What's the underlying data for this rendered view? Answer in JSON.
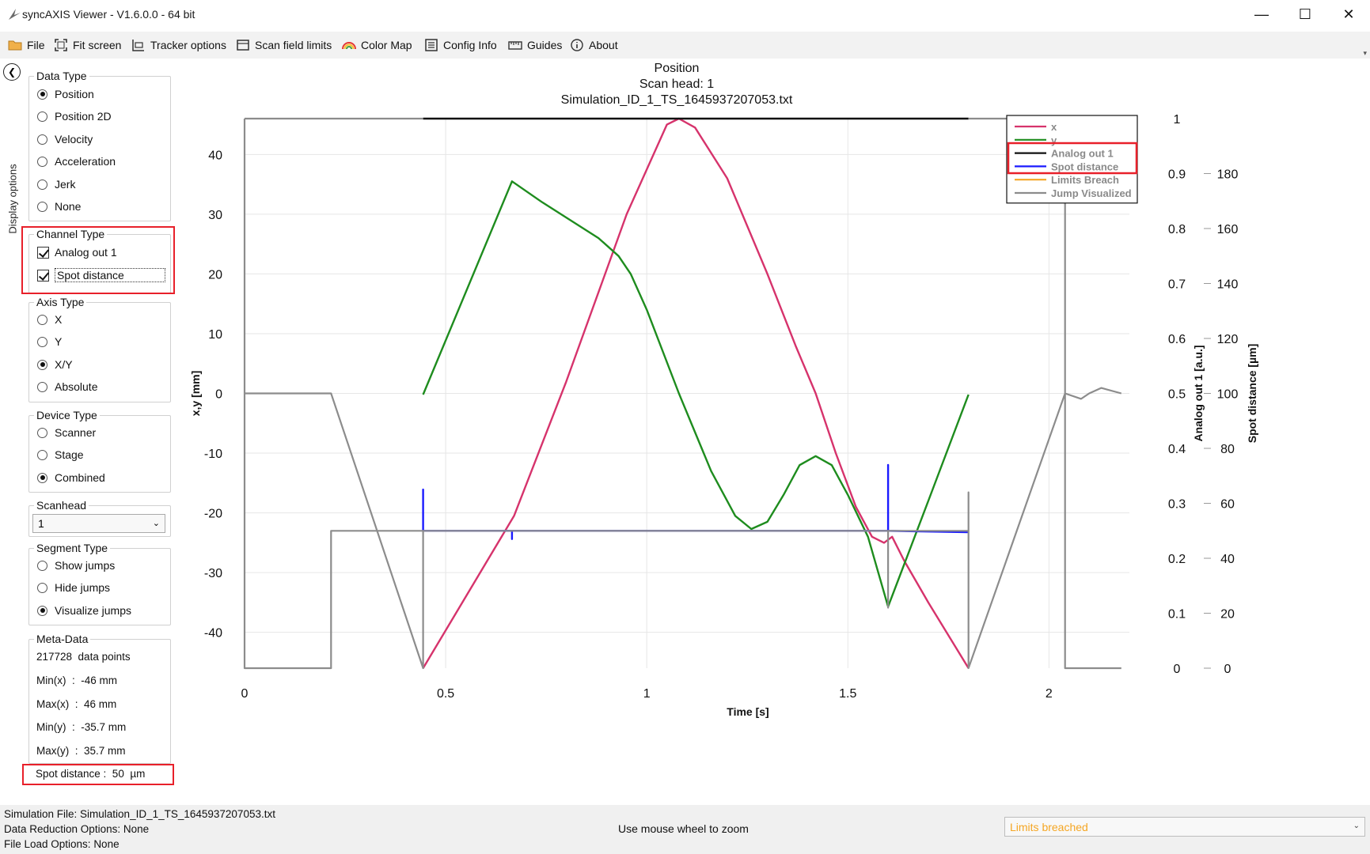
{
  "window": {
    "title": "syncAXIS Viewer - V1.6.0.0 - 64 bit",
    "minimize_glyph": "—",
    "maximize_glyph": "☐",
    "close_glyph": "✕"
  },
  "toolbar": {
    "items": [
      {
        "label": "File",
        "icon": "folder-icon"
      },
      {
        "label": "Fit screen",
        "icon": "fit-screen-icon"
      },
      {
        "label": "Tracker options",
        "icon": "tracker-icon"
      },
      {
        "label": "Scan field limits",
        "icon": "scan-field-icon"
      },
      {
        "label": "Color Map",
        "icon": "rainbow-icon"
      },
      {
        "label": "Config Info",
        "icon": "config-icon"
      },
      {
        "label": "Guides",
        "icon": "guides-icon"
      },
      {
        "label": "About",
        "icon": "info-icon"
      }
    ]
  },
  "side_panel": {
    "tab_label": "Display options",
    "data_type": {
      "title": "Data Type",
      "options": [
        "Position",
        "Position 2D",
        "Velocity",
        "Acceleration",
        "Jerk",
        "None"
      ],
      "selected": "Position"
    },
    "channel_type": {
      "title": "Channel Type",
      "options": [
        {
          "label": "Analog out 1",
          "checked": true
        },
        {
          "label": "Spot distance",
          "checked": true
        }
      ]
    },
    "axis_type": {
      "title": "Axis Type",
      "options": [
        "X",
        "Y",
        "X/Y",
        "Absolute"
      ],
      "selected": "X/Y"
    },
    "device_type": {
      "title": "Device Type",
      "options": [
        "Scanner",
        "Stage",
        "Combined"
      ],
      "selected": "Combined"
    },
    "scanhead": {
      "title": "Scanhead",
      "value": "1"
    },
    "segment_type": {
      "title": "Segment Type",
      "options": [
        "Show jumps",
        "Hide jumps",
        "Visualize jumps"
      ],
      "selected": "Visualize jumps"
    },
    "meta_data": {
      "title": "Meta-Data",
      "lines": [
        "217728  data points",
        "Min(x)  :  -46 mm",
        "Max(x)  :  46 mm",
        "Min(y)  :  -35.7 mm",
        "Max(y)  :  35.7 mm"
      ],
      "spot_distance": "Spot distance :  50  µm"
    }
  },
  "chart_data": {
    "type": "line",
    "title": "Position",
    "subtitle": "Scan head: 1",
    "file_title": "Simulation_ID_1_TS_1645937207053.txt",
    "xlabel": "Time [s]",
    "ylabel_left": "x,y [mm]",
    "ylabel_right1": "Analog out 1 [a.u.]",
    "ylabel_right2": "Spot distance [µm]",
    "xlim": [
      0,
      2.2
    ],
    "ylim_left": [
      -46,
      46
    ],
    "ylim_right1": [
      0,
      1
    ],
    "ylim_right2": [
      0,
      200
    ],
    "x_ticks": [
      {
        "value": 0,
        "label": "0"
      },
      {
        "value": 0.5,
        "label": "0.5"
      },
      {
        "value": 1,
        "label": "1"
      },
      {
        "value": 1.5,
        "label": "1.5"
      },
      {
        "value": 2,
        "label": "2"
      }
    ],
    "y_left_ticks": [
      40,
      30,
      20,
      10,
      0,
      -10,
      -20,
      -30,
      -40
    ],
    "y_left_tick_labels": [
      "40",
      "30",
      "20",
      "10",
      "0",
      "-10",
      "-20",
      "-30",
      "-40"
    ],
    "y_right1_ticks": [
      1,
      0.9,
      0.8,
      0.7,
      0.6,
      0.5,
      0.4,
      0.3,
      0.2,
      0.1,
      0
    ],
    "y_right1_tick_labels": [
      "1",
      "0.9",
      "0.8",
      "0.7",
      "0.6",
      "0.5",
      "0.4",
      "0.3",
      "0.2",
      "0.1",
      "0"
    ],
    "y_right2_ticks": [
      180,
      160,
      140,
      120,
      100,
      80,
      60,
      40,
      20,
      0
    ],
    "y_right2_tick_labels": [
      "180",
      "160",
      "140",
      "120",
      "100",
      "80",
      "60",
      "40",
      "20",
      "0"
    ],
    "grid": true,
    "legend_position": "top-right",
    "series": [
      {
        "name": "x",
        "axis": "left",
        "color": "#d6336c",
        "points": [
          [
            0.444,
            -46
          ],
          [
            0.67,
            -20.5
          ],
          [
            0.8,
            2
          ],
          [
            0.95,
            30
          ],
          [
            1.05,
            45
          ],
          [
            1.08,
            46
          ],
          [
            1.12,
            44.5
          ],
          [
            1.2,
            36
          ],
          [
            1.3,
            20
          ],
          [
            1.37,
            8
          ],
          [
            1.42,
            0
          ],
          [
            1.47,
            -10
          ],
          [
            1.52,
            -19
          ],
          [
            1.56,
            -24
          ],
          [
            1.59,
            -25
          ],
          [
            1.61,
            -24
          ],
          [
            1.64,
            -28
          ],
          [
            1.7,
            -35
          ],
          [
            1.8,
            -46
          ]
        ]
      },
      {
        "name": "y",
        "axis": "left",
        "color": "#1e8c1e",
        "points": [
          [
            0.444,
            -0.2
          ],
          [
            0.665,
            35.5
          ],
          [
            0.74,
            32
          ],
          [
            0.88,
            26
          ],
          [
            0.93,
            23
          ],
          [
            0.96,
            20
          ],
          [
            1.0,
            14
          ],
          [
            1.08,
            0
          ],
          [
            1.16,
            -13
          ],
          [
            1.22,
            -20.5
          ],
          [
            1.26,
            -22.7
          ],
          [
            1.3,
            -21.5
          ],
          [
            1.34,
            -17
          ],
          [
            1.38,
            -12
          ],
          [
            1.42,
            -10.5
          ],
          [
            1.46,
            -12
          ],
          [
            1.5,
            -17
          ],
          [
            1.55,
            -24
          ],
          [
            1.6,
            -35.7
          ],
          [
            1.7,
            -18
          ],
          [
            1.8,
            -0.2
          ]
        ]
      },
      {
        "name": "Analog out 1",
        "axis": "right1",
        "color": "#111111",
        "points": [
          [
            0.444,
            1
          ],
          [
            1.8,
            1
          ]
        ]
      },
      {
        "name": "Spot distance",
        "axis": "right2",
        "color": "#1a1aff",
        "points": [
          [
            0.444,
            50
          ],
          [
            0.444,
            65
          ],
          [
            0.444,
            50
          ],
          [
            0.665,
            50
          ],
          [
            0.665,
            47
          ],
          [
            0.665,
            50
          ],
          [
            1.6,
            50
          ],
          [
            1.6,
            74
          ],
          [
            1.6,
            50
          ],
          [
            1.8,
            49.5
          ]
        ]
      },
      {
        "name": "Limits Breach",
        "axis": "right1",
        "color": "#f5a623",
        "points": []
      },
      {
        "name": "Jump Visualized",
        "axis": "right1",
        "color": "#8c8c8c",
        "points": [
          [
            0,
            0.5
          ],
          [
            0.215,
            0.5
          ],
          [
            0.444,
            0
          ],
          [
            0.444,
            0.155
          ],
          [
            0.444,
            0
          ],
          [
            0.444,
            0.25
          ],
          [
            1.6,
            0.25
          ],
          [
            1.6,
            0.24
          ],
          [
            1.6,
            0.11
          ],
          [
            1.6,
            0.25
          ],
          [
            1.8,
            0.25
          ],
          [
            1.8,
            0.175
          ],
          [
            1.8,
            0.32
          ],
          [
            1.8,
            0
          ],
          [
            2.04,
            0.5
          ],
          [
            2.04,
            1.0
          ],
          [
            2.04,
            0
          ],
          [
            2.04,
            0.25
          ],
          [
            2.04,
            0.5
          ],
          [
            2.08,
            0.49
          ],
          [
            2.1,
            0.5
          ],
          [
            2.13,
            0.51
          ],
          [
            2.18,
            0.5
          ]
        ]
      },
      {
        "name": "Jump Visualized",
        "axis": "right1",
        "color": "#8c8c8c",
        "show_in_legend": false,
        "points": [
          [
            0,
            1
          ],
          [
            0.444,
            1
          ]
        ]
      },
      {
        "name": "Jump Visualized",
        "axis": "right1",
        "color": "#8c8c8c",
        "show_in_legend": false,
        "points": [
          [
            1.8,
            1
          ],
          [
            2.04,
            1
          ]
        ]
      },
      {
        "name": "Jump Visualized",
        "axis": "right1",
        "color": "#8c8c8c",
        "show_in_legend": false,
        "points": [
          [
            0,
            1
          ],
          [
            0,
            0
          ],
          [
            0.215,
            0
          ],
          [
            0.215,
            0.25
          ],
          [
            0.444,
            0.25
          ]
        ]
      },
      {
        "name": "Jump Visualized",
        "axis": "right1",
        "color": "#8c8c8c",
        "show_in_legend": false,
        "points": [
          [
            2.04,
            0
          ],
          [
            2.18,
            0
          ]
        ]
      }
    ]
  },
  "status_bar": {
    "simulation_file": "Simulation File: Simulation_ID_1_TS_1645937207053.txt",
    "data_reduction": "Data Reduction Options: None",
    "file_load": "File Load Options:  None",
    "zoom_hint": "Use mouse wheel to zoom",
    "limits_status": "Limits breached"
  },
  "colors": {
    "highlight_red": "#e8202a",
    "limits_orange": "#f5a623",
    "grid": "#e6e6e6"
  }
}
